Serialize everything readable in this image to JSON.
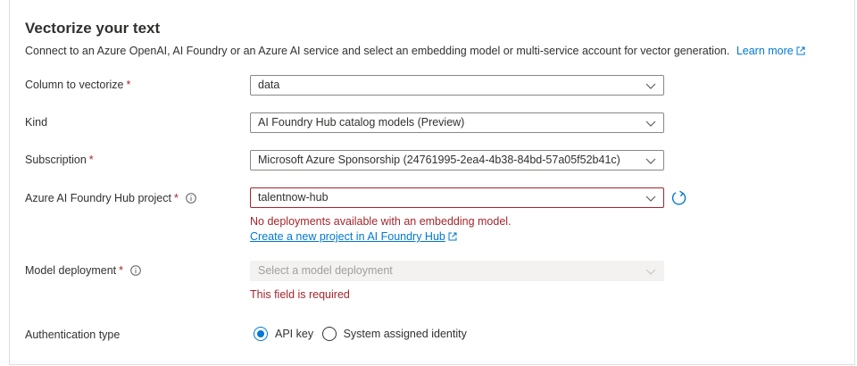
{
  "section": {
    "title": "Vectorize your text",
    "description": "Connect to an Azure OpenAI, AI Foundry or an Azure AI service and select an embedding model or multi-service account for vector generation.",
    "learn_more": "Learn more"
  },
  "fields": {
    "column": {
      "label": "Column to vectorize",
      "required": "*",
      "value": "data"
    },
    "kind": {
      "label": "Kind",
      "value": "AI Foundry Hub catalog models (Preview)"
    },
    "subscription": {
      "label": "Subscription",
      "required": "*",
      "value": "Microsoft Azure Sponsorship (24761995-2ea4-4b38-84bd-57a05f52b41c)"
    },
    "project": {
      "label": "Azure AI Foundry Hub project",
      "required": "*",
      "value": "talentnow-hub",
      "error": "No deployments available with an embedding model.",
      "create_link": "Create a new project in AI Foundry Hub"
    },
    "model": {
      "label": "Model deployment",
      "required": "*",
      "placeholder": "Select a model deployment",
      "error": "This field is required"
    },
    "auth": {
      "label": "Authentication type",
      "options": [
        "API key",
        "System assigned identity"
      ],
      "selected": "API key"
    }
  },
  "colors": {
    "accent": "#0078d4",
    "error": "#a4262c",
    "text": "#323130",
    "disabled_bg": "#f3f2f1"
  }
}
